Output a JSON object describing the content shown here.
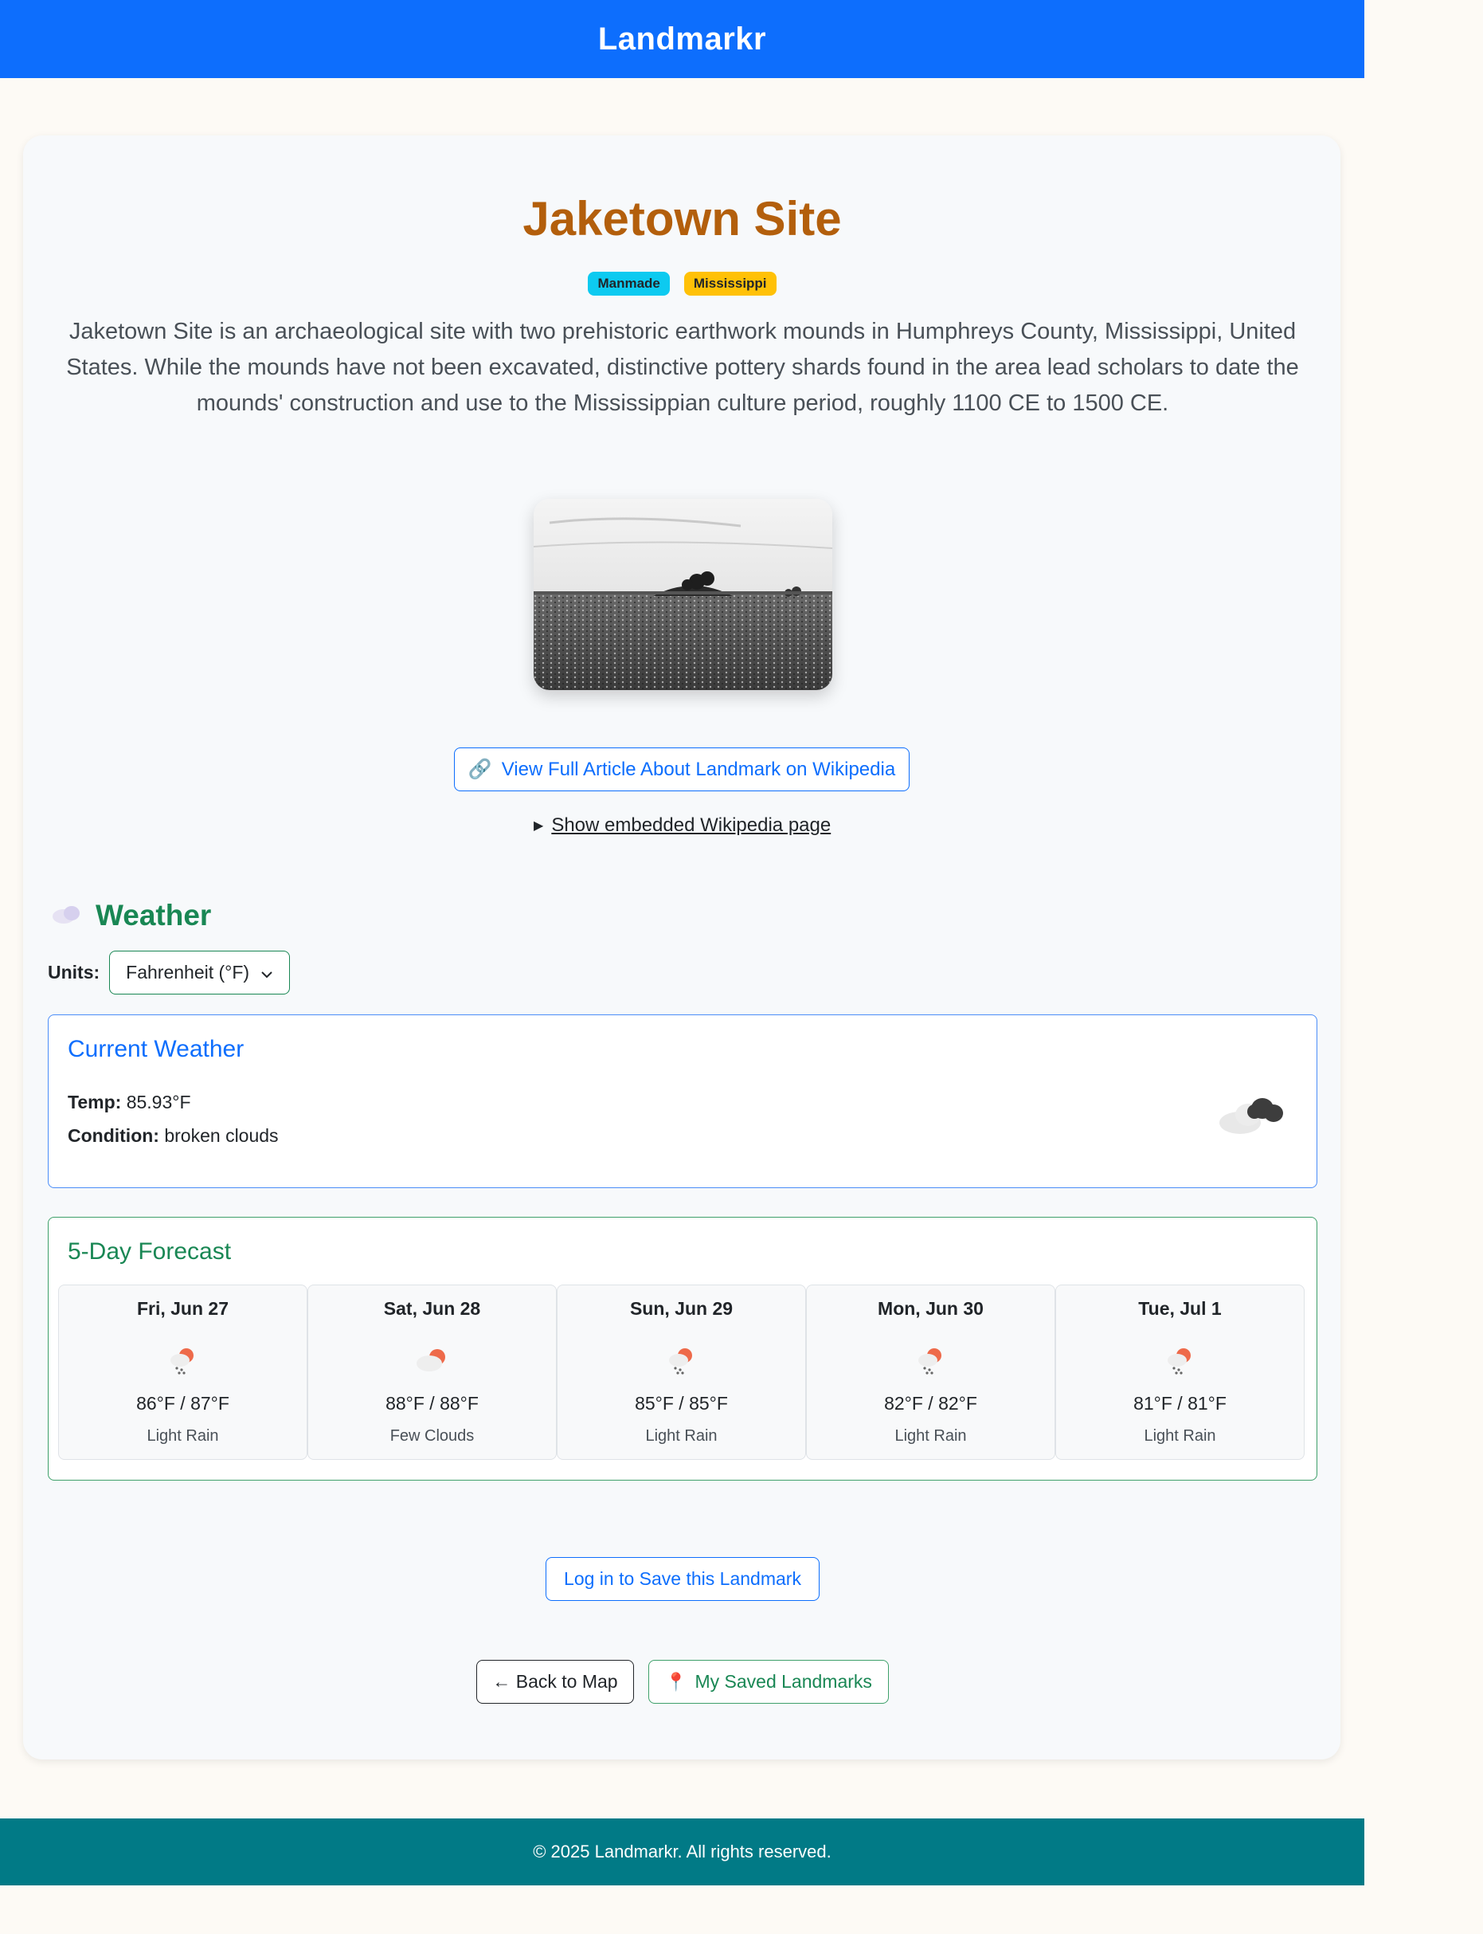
{
  "app": {
    "brand": "Landmarkr"
  },
  "landmark": {
    "name": "Jaketown Site",
    "badges": {
      "type": "Manmade",
      "state": "Mississippi"
    },
    "description": "Jaketown Site is an archaeological site with two prehistoric earthwork mounds in Humphreys County, Mississippi, United States. While the mounds have not been excavated, distinctive pottery shards found in the area lead scholars to date the mounds' construction and use to the Mississippian culture period, roughly 1100 CE to 1500 CE.",
    "wiki_button": "View Full Article About Landmark on Wikipedia",
    "embed_toggle": "Show embedded Wikipedia page"
  },
  "weather": {
    "heading": "Weather",
    "units_label": "Units:",
    "units_value": "Fahrenheit (°F)",
    "current": {
      "heading": "Current Weather",
      "temp_label": "Temp:",
      "temp_value": "85.93°F",
      "condition_label": "Condition:",
      "condition_value": "broken clouds",
      "icon": "broken-clouds-icon"
    },
    "forecast": {
      "heading": "5-Day Forecast",
      "days": [
        {
          "day": "Fri, Jun 27",
          "temps": "86°F / 87°F",
          "condition": "Light Rain",
          "icon": "light-rain-icon"
        },
        {
          "day": "Sat, Jun 28",
          "temps": "88°F / 88°F",
          "condition": "Few Clouds",
          "icon": "few-clouds-icon"
        },
        {
          "day": "Sun, Jun 29",
          "temps": "85°F / 85°F",
          "condition": "Light Rain",
          "icon": "light-rain-icon"
        },
        {
          "day": "Mon, Jun 30",
          "temps": "82°F / 82°F",
          "condition": "Light Rain",
          "icon": "light-rain-icon"
        },
        {
          "day": "Tue, Jul 1",
          "temps": "81°F / 81°F",
          "condition": "Light Rain",
          "icon": "light-rain-icon"
        }
      ]
    }
  },
  "actions": {
    "save": "Log in to Save this Landmark",
    "back": "← Back to Map",
    "saved": "My Saved Landmarks"
  },
  "footer": {
    "text": "© 2025 Landmarkr. All rights reserved."
  },
  "colors": {
    "primary": "#0d6efd",
    "title": "#b35f0c",
    "success": "#198754",
    "footer": "#017a86",
    "badge_type": "#0dcaf0",
    "badge_state": "#ffc107"
  }
}
